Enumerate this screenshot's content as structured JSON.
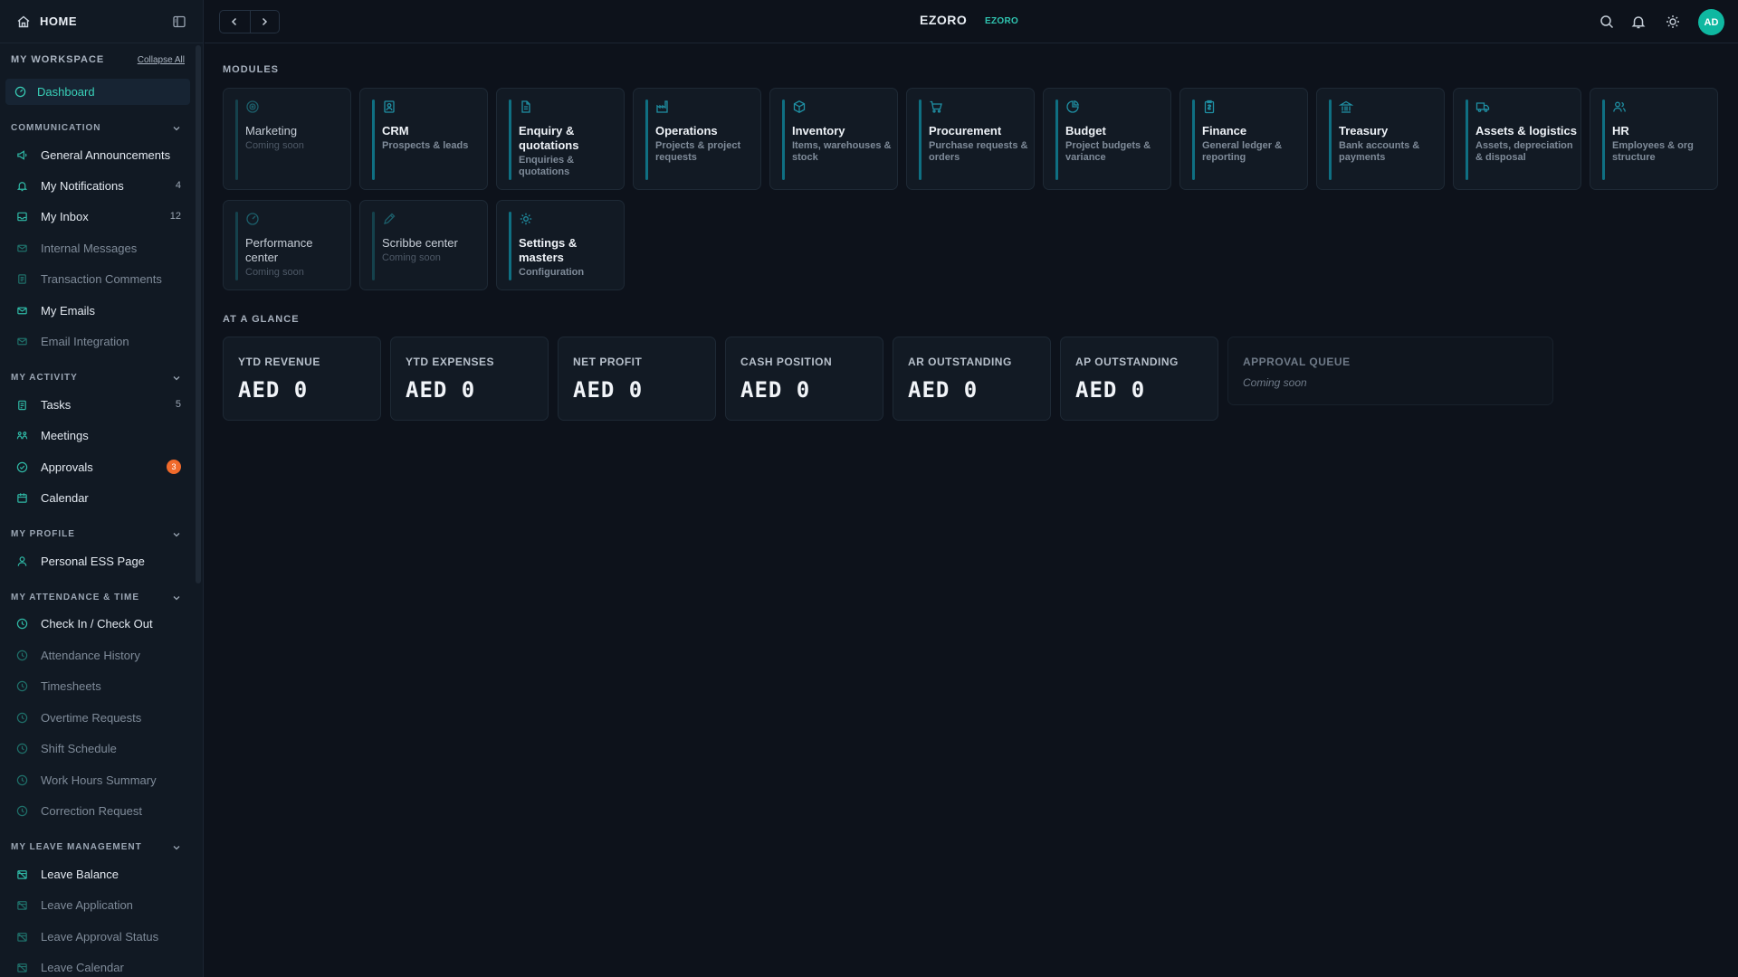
{
  "sidebar": {
    "home_label": "HOME",
    "workspace_title": "MY WORKSPACE",
    "collapse_all": "Collapse All",
    "dashboard": "Dashboard",
    "groups": {
      "communication": "COMMUNICATION",
      "activity": "MY ACTIVITY",
      "profile": "MY PROFILE",
      "attendance": "MY ATTENDANCE & TIME",
      "leave": "MY LEAVE MANAGEMENT"
    },
    "items": {
      "announcements": "General Announcements",
      "notifications": "My Notifications",
      "notifications_count": "4",
      "inbox": "My Inbox",
      "inbox_count": "12",
      "internal_messages": "Internal Messages",
      "transaction_comments": "Transaction Comments",
      "emails": "My Emails",
      "email_integration": "Email Integration",
      "tasks": "Tasks",
      "tasks_count": "5",
      "meetings": "Meetings",
      "approvals": "Approvals",
      "approvals_badge": "3",
      "calendar": "Calendar",
      "ess": "Personal ESS Page",
      "checkin": "Check In / Check Out",
      "attendance_history": "Attendance History",
      "timesheets": "Timesheets",
      "overtime": "Overtime Requests",
      "shift": "Shift Schedule",
      "work_hours": "Work Hours Summary",
      "correction": "Correction Request",
      "leave_balance": "Leave Balance",
      "leave_application": "Leave Application",
      "leave_approval_status": "Leave Approval Status",
      "leave_calendar": "Leave Calendar"
    }
  },
  "topbar": {
    "brand": "EZORO",
    "brand_chip": "EZORO",
    "avatar": "AD"
  },
  "main": {
    "modules_label": "MODULES",
    "glance_label": "AT A GLANCE",
    "modules": [
      {
        "title": "Marketing",
        "sub": "Coming soon",
        "icon": "target-icon"
      },
      {
        "title": "CRM",
        "sub": "Prospects & leads",
        "icon": "contact-card-icon"
      },
      {
        "title": "Enquiry & quotations",
        "sub": "Enquiries & quotations",
        "icon": "document-icon"
      },
      {
        "title": "Operations",
        "sub": "Projects & project requests",
        "icon": "factory-icon"
      },
      {
        "title": "Inventory",
        "sub": "Items, warehouses & stock",
        "icon": "box-icon"
      },
      {
        "title": "Procurement",
        "sub": "Purchase requests & orders",
        "icon": "cart-icon"
      },
      {
        "title": "Budget",
        "sub": "Project budgets & variance",
        "icon": "pie-chart-icon"
      },
      {
        "title": "Finance",
        "sub": "General ledger & reporting",
        "icon": "ledger-icon"
      },
      {
        "title": "Treasury",
        "sub": "Bank accounts & payments",
        "icon": "bank-icon"
      },
      {
        "title": "Assets & logistics",
        "sub": "Assets, depreciation & disposal",
        "icon": "truck-icon"
      },
      {
        "title": "HR",
        "sub": "Employees & org structure",
        "icon": "people-icon"
      },
      {
        "title": "Performance center",
        "sub": "Coming soon",
        "icon": "gauge-icon"
      },
      {
        "title": "Scribbe center",
        "sub": "Coming soon",
        "icon": "pen-icon"
      },
      {
        "title": "Settings & masters",
        "sub": "Configuration",
        "icon": "gear-icon"
      }
    ],
    "kpis": [
      {
        "label": "YTD REVENUE",
        "value": "AED 0"
      },
      {
        "label": "YTD EXPENSES",
        "value": "AED 0"
      },
      {
        "label": "NET PROFIT",
        "value": "AED 0"
      },
      {
        "label": "CASH POSITION",
        "value": "AED 0"
      },
      {
        "label": "AR OUTSTANDING",
        "value": "AED 0"
      },
      {
        "label": "AP OUTSTANDING",
        "value": "AED 0"
      }
    ],
    "queue": {
      "label": "APPROVAL QUEUE",
      "sub": "Coming soon"
    }
  },
  "colors": {
    "accent": "#2fc4b0",
    "module_bar": "#0f6f82",
    "badge": "#f06a2b",
    "background": "#0d121b"
  }
}
